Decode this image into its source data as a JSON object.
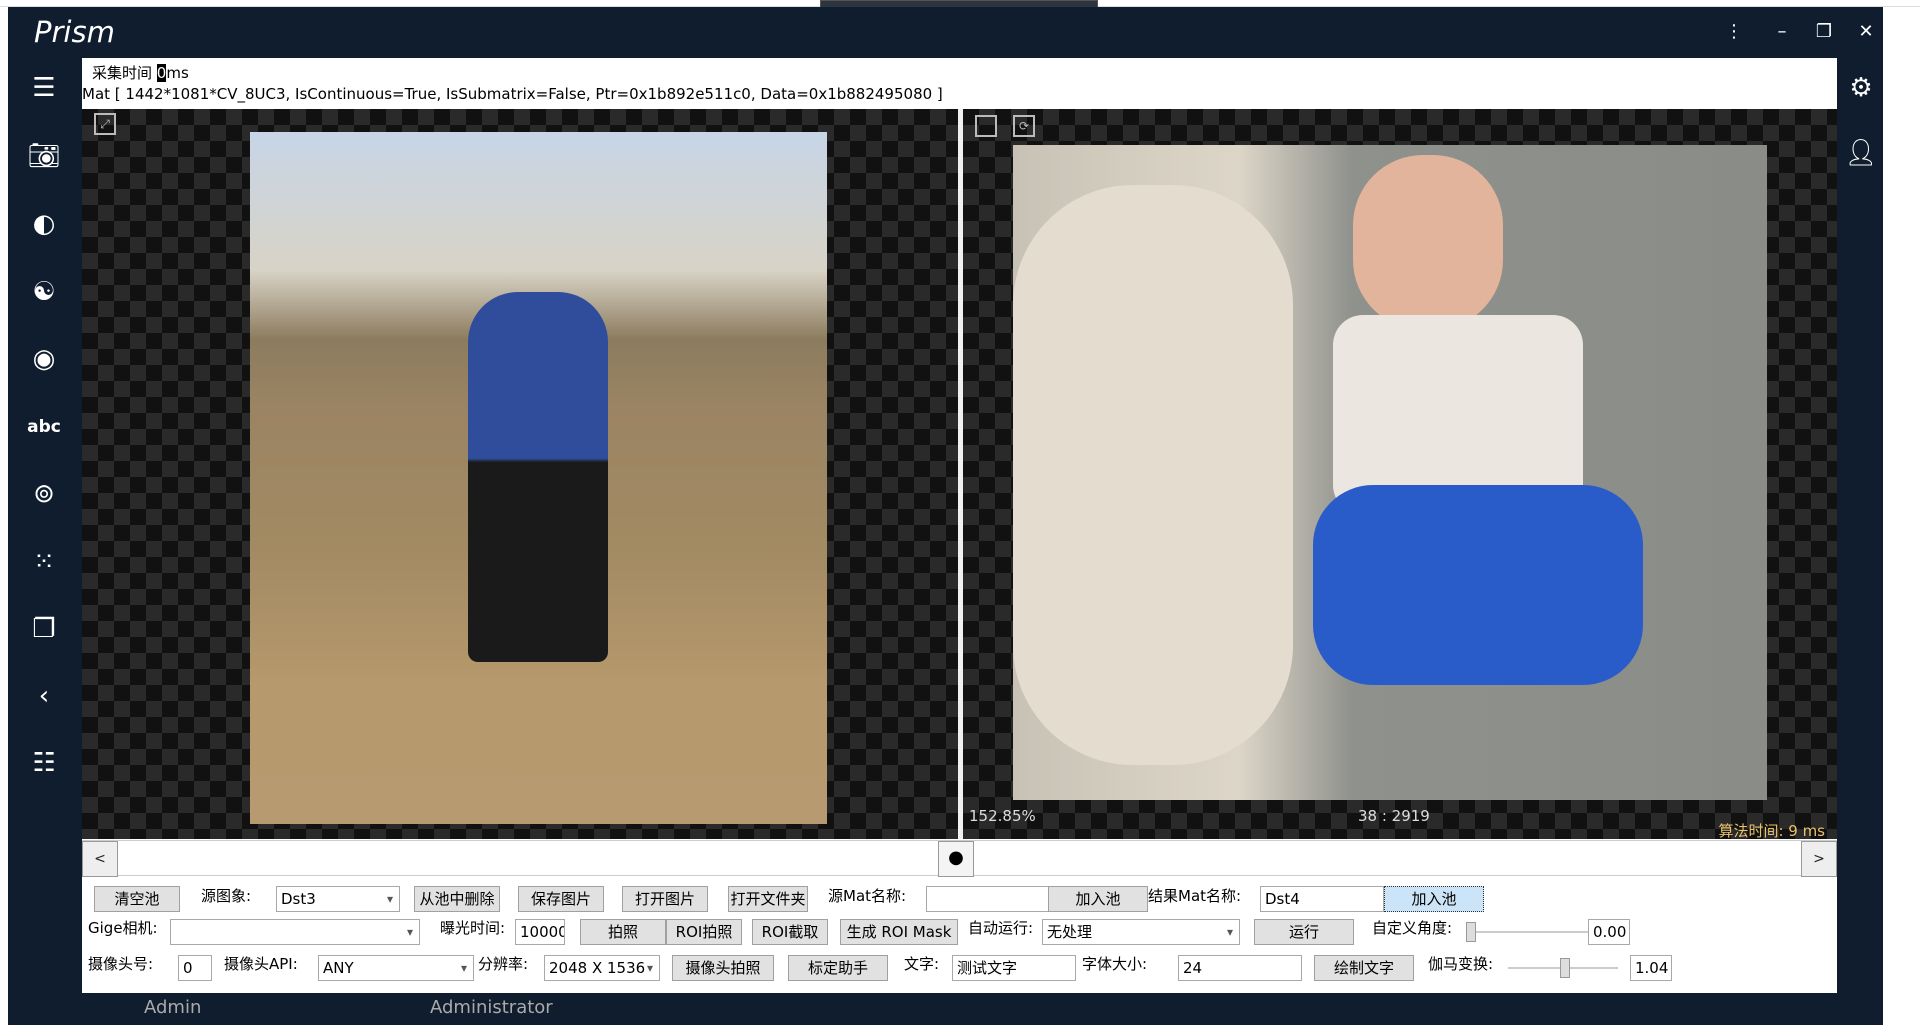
{
  "app": {
    "title": "Prism"
  },
  "info": {
    "capture_label": "采集时间",
    "capture_value": "0",
    "capture_unit": "ms",
    "mat_info": "Mat [ 1442*1081*CV_8UC3, IsContinuous=True, IsSubmatrix=False, Ptr=0x1b892e511c0, Data=0x1b882495080 ]"
  },
  "viewer": {
    "zoom": "152.85%",
    "coord": "38 : 2919",
    "algo_time": "算法时间: 9 ms"
  },
  "nav": {
    "prev": "<",
    "next": ">",
    "center": "●"
  },
  "row1": {
    "clear_pool": "清空池",
    "source_label": "源图象:",
    "source_value": "Dst3",
    "remove_from_pool": "从池中删除",
    "save_image": "保存图片",
    "open_image": "打开图片",
    "open_folder": "打开文件夹",
    "src_mat_label": "源Mat名称:",
    "src_mat_value": "",
    "add_pool": "加入池",
    "result_mat_label": "结果Mat名称:",
    "result_mat_value": "Dst4",
    "add_pool2": "加入池"
  },
  "row2": {
    "gige_label": "Gige相机:",
    "gige_value": "",
    "exposure_label": "曝光时间:",
    "exposure_value": "10000",
    "shoot": "拍照",
    "roi_shoot": "ROI拍照",
    "roi_crop": "ROI截取",
    "gen_roi_mask": "生成 ROI Mask",
    "auto_run_label": "自动运行:",
    "auto_run_value": "无处理",
    "run": "运行",
    "angle_label": "自定义角度:",
    "angle_value": "0.00",
    "angle_level": 0.0
  },
  "row3": {
    "cam_no_label": "摄像头号:",
    "cam_no_value": "0",
    "cam_api_label": "摄像头API:",
    "cam_api_value": "ANY",
    "resolution_label": "分辨率:",
    "resolution_value": "2048 X 1536",
    "cam_shoot": "摄像头拍照",
    "calib": "标定助手",
    "text_label": "文字:",
    "text_value": "测试文字",
    "font_size_label": "字体大小:",
    "font_size_value": "24",
    "draw_text": "绘制文字",
    "gamma_label": "伽马变换:",
    "gamma_value": "1.04",
    "gamma_level": 0.52
  },
  "status": {
    "user": "Admin",
    "role": "Administrator"
  },
  "icons": {
    "left": [
      "menu-icon",
      "camera-icon",
      "contrast-icon",
      "yin-yang-icon",
      "circle-icon",
      "abc-icon",
      "fingerprint-icon",
      "dots-icon",
      "copy-icon",
      "back-icon",
      "document-icon"
    ],
    "right": [
      "gear-icon",
      "user-icon"
    ]
  }
}
